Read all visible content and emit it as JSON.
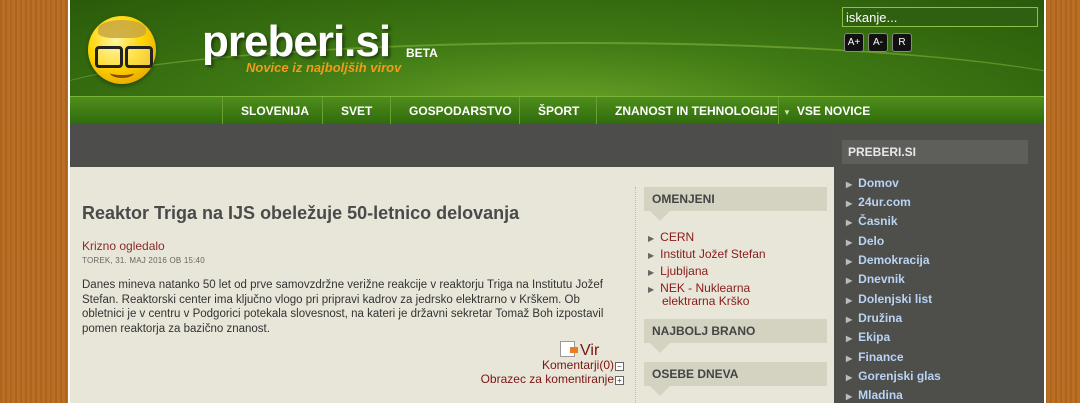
{
  "header": {
    "logo_text": "preberi.si",
    "beta": "BETA",
    "tagline": "Novice iz najboljših virov",
    "search_value": "iskanje...",
    "font_buttons": [
      "A+",
      "A-",
      "R"
    ]
  },
  "nav": {
    "items": [
      "SLOVENIJA",
      "SVET",
      "GOSPODARSTVO",
      "ŠPORT",
      "ZNANOST IN TEHNOLOGIJE",
      "VSE NOVICE"
    ]
  },
  "article": {
    "title": "Reaktor Triga na IJS obeležuje 50-letnico delovanja",
    "source": "Krizno ogledalo",
    "date": "TOREK, 31. MAJ 2016 OB 15:40",
    "body": "Danes mineva natanko 50 let od prve samovzdržne verižne reakcije v reaktorju Triga na Institutu Jožef Stefan. Reaktorski center ima ključno vlogo pri pripravi kadrov za jedrsko elektrarno v Krškem. Ob obletnici je v centru v Podgorici potekala slovesnost, na kateri je državni sekretar Tomaž Boh izpostavil pomen reaktorja za bazično znanost.",
    "read_label": "Vir",
    "comments_label": "Komentarji(0)",
    "comment_form_label": "Obrazec za komentiranje"
  },
  "mid_sidebar": {
    "omenjeni_title": "OMENJENI",
    "omenjeni": [
      "CERN",
      "Institut Jožef Stefan",
      "Ljubljana",
      "NEK - Nuklearna",
      "elektrarna Krško"
    ],
    "najbolj_brano_title": "NAJBOLJ BRANO",
    "osebe_dneva_title": "OSEBE DNEVA"
  },
  "right_sidebar": {
    "title": "PREBERI.SI",
    "items": [
      "Domov",
      "24ur.com",
      "Časnik",
      "Delo",
      "Demokracija",
      "Dnevnik",
      "Dolenjski list",
      "Družina",
      "Ekipa",
      "Finance",
      "Gorenjski glas",
      "Mladina"
    ]
  },
  "colors": {
    "header_green": "#3f7a14",
    "tagline_orange": "#f29a1c",
    "link_red": "#8a1a1a",
    "sidebar_link_blue": "#b8d3f5",
    "page_bg": "#e8e6d8"
  }
}
